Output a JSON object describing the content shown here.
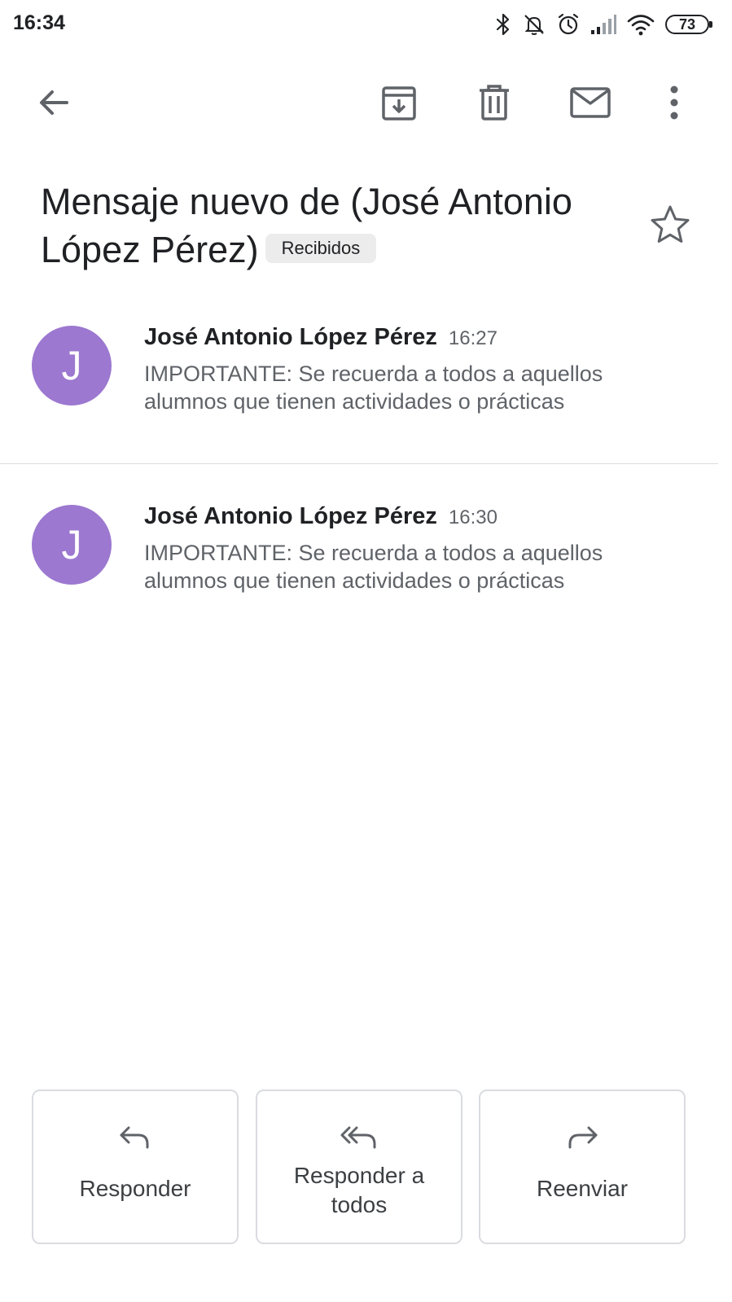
{
  "status_bar": {
    "time": "16:34",
    "battery": "73",
    "icons": [
      "bluetooth-icon",
      "notifications-off-icon",
      "alarm-icon",
      "signal-icon",
      "wifi-icon",
      "battery-icon"
    ]
  },
  "toolbar": {
    "icons": [
      "back-arrow-icon",
      "archive-icon",
      "delete-icon",
      "mark-unread-icon",
      "more-vert-icon"
    ]
  },
  "email": {
    "subject": "Mensaje nuevo de (José Antonio López Pérez)",
    "label": "Recibidos",
    "starred": false
  },
  "messages": [
    {
      "avatar_letter": "J",
      "sender": "José Antonio López Pérez",
      "time": "16:27",
      "snippet": "IMPORTANTE: Se recuerda a todos a aquellos alumnos que tienen actividades o prácticas"
    },
    {
      "avatar_letter": "J",
      "sender": "José Antonio López Pérez",
      "time": "16:30",
      "snippet": "IMPORTANTE: Se recuerda a todos a aquellos alumnos que tienen actividades o prácticas"
    }
  ],
  "actions": {
    "reply": "Responder",
    "reply_all": "Responder a todos",
    "forward": "Reenviar"
  },
  "colors": {
    "avatar": "#9c78d0",
    "icon": "#5f6368",
    "text_primary": "#202124",
    "text_secondary": "#5f6368",
    "chip_background": "#ececec",
    "border": "#dadce0"
  }
}
